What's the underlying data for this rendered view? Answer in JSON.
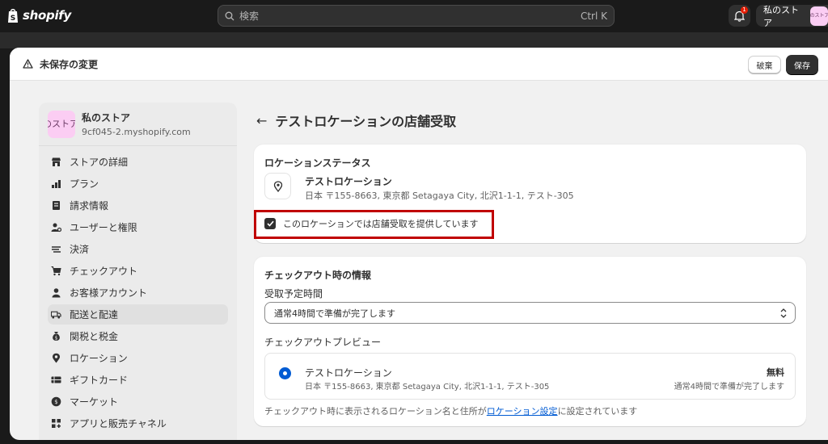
{
  "topbar": {
    "logo_text": "shopify",
    "search_placeholder": "検索",
    "search_shortcut": "Ctrl K",
    "notification_count": "1",
    "store_name": "私のストア",
    "store_avatar_text": "のストア"
  },
  "modal": {
    "unsaved_label": "未保存の変更",
    "discard_label": "破棄",
    "save_label": "保存"
  },
  "sidebar": {
    "avatar_text": "のストア",
    "store_name": "私のストア",
    "store_domain": "9cf045-2.myshopify.com",
    "items": [
      {
        "label": "ストアの詳細",
        "icon": "store-icon"
      },
      {
        "label": "プラン",
        "icon": "plan-icon"
      },
      {
        "label": "請求情報",
        "icon": "billing-icon"
      },
      {
        "label": "ユーザーと権限",
        "icon": "users-icon"
      },
      {
        "label": "決済",
        "icon": "payments-icon"
      },
      {
        "label": "チェックアウト",
        "icon": "cart-icon"
      },
      {
        "label": "お客様アカウント",
        "icon": "person-icon"
      },
      {
        "label": "配送と配達",
        "icon": "truck-icon",
        "active": true
      },
      {
        "label": "関税と税金",
        "icon": "tax-icon"
      },
      {
        "label": "ロケーション",
        "icon": "location-icon"
      },
      {
        "label": "ギフトカード",
        "icon": "gift-card-icon"
      },
      {
        "label": "マーケット",
        "icon": "globe-icon"
      },
      {
        "label": "アプリと販売チャネル",
        "icon": "apps-icon"
      }
    ]
  },
  "page": {
    "title": "テストロケーションの店舗受取"
  },
  "status_card": {
    "title": "ロケーションステータス",
    "location_name": "テストロケーション",
    "location_address": "日本 〒155-8663, 東京都 Setagaya City, 北沢1-1-1, テスト-305",
    "checkbox_label": "このロケーションでは店舗受取を提供しています",
    "checkbox_checked": true
  },
  "checkout_card": {
    "title": "チェックアウト時の情報",
    "pickup_time_label": "受取予定時間",
    "pickup_time_value": "通常4時間で準備が完了します",
    "preview_label": "チェックアウトプレビュー",
    "preview_name": "テストロケーション",
    "preview_address": "日本 〒155-8663, 東京都 Setagaya City, 北沢1-1-1, テスト-305",
    "preview_price": "無料",
    "preview_time": "通常4時間で準備が完了します",
    "note_before": "チェックアウト時に表示されるロケーション名と住所が",
    "note_link": "ロケーション設定",
    "note_after": "に設定されています"
  }
}
